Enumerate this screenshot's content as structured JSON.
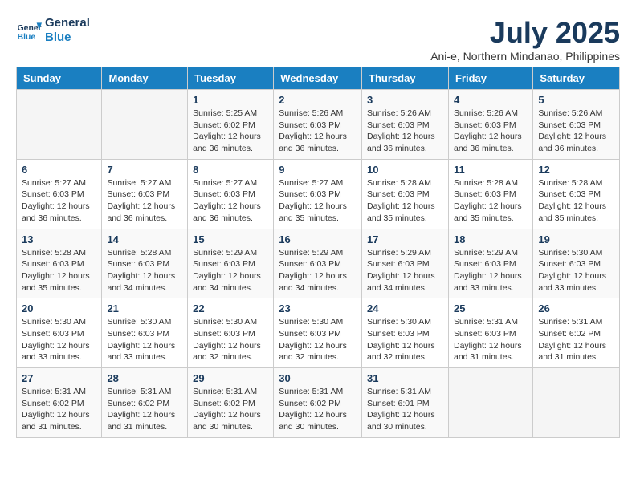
{
  "header": {
    "logo_line1": "General",
    "logo_line2": "Blue",
    "main_title": "July 2025",
    "subtitle": "Ani-e, Northern Mindanao, Philippines"
  },
  "weekdays": [
    "Sunday",
    "Monday",
    "Tuesday",
    "Wednesday",
    "Thursday",
    "Friday",
    "Saturday"
  ],
  "weeks": [
    [
      {
        "day": "",
        "detail": ""
      },
      {
        "day": "",
        "detail": ""
      },
      {
        "day": "1",
        "detail": "Sunrise: 5:25 AM\nSunset: 6:02 PM\nDaylight: 12 hours\nand 36 minutes."
      },
      {
        "day": "2",
        "detail": "Sunrise: 5:26 AM\nSunset: 6:03 PM\nDaylight: 12 hours\nand 36 minutes."
      },
      {
        "day": "3",
        "detail": "Sunrise: 5:26 AM\nSunset: 6:03 PM\nDaylight: 12 hours\nand 36 minutes."
      },
      {
        "day": "4",
        "detail": "Sunrise: 5:26 AM\nSunset: 6:03 PM\nDaylight: 12 hours\nand 36 minutes."
      },
      {
        "day": "5",
        "detail": "Sunrise: 5:26 AM\nSunset: 6:03 PM\nDaylight: 12 hours\nand 36 minutes."
      }
    ],
    [
      {
        "day": "6",
        "detail": "Sunrise: 5:27 AM\nSunset: 6:03 PM\nDaylight: 12 hours\nand 36 minutes."
      },
      {
        "day": "7",
        "detail": "Sunrise: 5:27 AM\nSunset: 6:03 PM\nDaylight: 12 hours\nand 36 minutes."
      },
      {
        "day": "8",
        "detail": "Sunrise: 5:27 AM\nSunset: 6:03 PM\nDaylight: 12 hours\nand 36 minutes."
      },
      {
        "day": "9",
        "detail": "Sunrise: 5:27 AM\nSunset: 6:03 PM\nDaylight: 12 hours\nand 35 minutes."
      },
      {
        "day": "10",
        "detail": "Sunrise: 5:28 AM\nSunset: 6:03 PM\nDaylight: 12 hours\nand 35 minutes."
      },
      {
        "day": "11",
        "detail": "Sunrise: 5:28 AM\nSunset: 6:03 PM\nDaylight: 12 hours\nand 35 minutes."
      },
      {
        "day": "12",
        "detail": "Sunrise: 5:28 AM\nSunset: 6:03 PM\nDaylight: 12 hours\nand 35 minutes."
      }
    ],
    [
      {
        "day": "13",
        "detail": "Sunrise: 5:28 AM\nSunset: 6:03 PM\nDaylight: 12 hours\nand 35 minutes."
      },
      {
        "day": "14",
        "detail": "Sunrise: 5:28 AM\nSunset: 6:03 PM\nDaylight: 12 hours\nand 34 minutes."
      },
      {
        "day": "15",
        "detail": "Sunrise: 5:29 AM\nSunset: 6:03 PM\nDaylight: 12 hours\nand 34 minutes."
      },
      {
        "day": "16",
        "detail": "Sunrise: 5:29 AM\nSunset: 6:03 PM\nDaylight: 12 hours\nand 34 minutes."
      },
      {
        "day": "17",
        "detail": "Sunrise: 5:29 AM\nSunset: 6:03 PM\nDaylight: 12 hours\nand 34 minutes."
      },
      {
        "day": "18",
        "detail": "Sunrise: 5:29 AM\nSunset: 6:03 PM\nDaylight: 12 hours\nand 33 minutes."
      },
      {
        "day": "19",
        "detail": "Sunrise: 5:30 AM\nSunset: 6:03 PM\nDaylight: 12 hours\nand 33 minutes."
      }
    ],
    [
      {
        "day": "20",
        "detail": "Sunrise: 5:30 AM\nSunset: 6:03 PM\nDaylight: 12 hours\nand 33 minutes."
      },
      {
        "day": "21",
        "detail": "Sunrise: 5:30 AM\nSunset: 6:03 PM\nDaylight: 12 hours\nand 33 minutes."
      },
      {
        "day": "22",
        "detail": "Sunrise: 5:30 AM\nSunset: 6:03 PM\nDaylight: 12 hours\nand 32 minutes."
      },
      {
        "day": "23",
        "detail": "Sunrise: 5:30 AM\nSunset: 6:03 PM\nDaylight: 12 hours\nand 32 minutes."
      },
      {
        "day": "24",
        "detail": "Sunrise: 5:30 AM\nSunset: 6:03 PM\nDaylight: 12 hours\nand 32 minutes."
      },
      {
        "day": "25",
        "detail": "Sunrise: 5:31 AM\nSunset: 6:03 PM\nDaylight: 12 hours\nand 31 minutes."
      },
      {
        "day": "26",
        "detail": "Sunrise: 5:31 AM\nSunset: 6:02 PM\nDaylight: 12 hours\nand 31 minutes."
      }
    ],
    [
      {
        "day": "27",
        "detail": "Sunrise: 5:31 AM\nSunset: 6:02 PM\nDaylight: 12 hours\nand 31 minutes."
      },
      {
        "day": "28",
        "detail": "Sunrise: 5:31 AM\nSunset: 6:02 PM\nDaylight: 12 hours\nand 31 minutes."
      },
      {
        "day": "29",
        "detail": "Sunrise: 5:31 AM\nSunset: 6:02 PM\nDaylight: 12 hours\nand 30 minutes."
      },
      {
        "day": "30",
        "detail": "Sunrise: 5:31 AM\nSunset: 6:02 PM\nDaylight: 12 hours\nand 30 minutes."
      },
      {
        "day": "31",
        "detail": "Sunrise: 5:31 AM\nSunset: 6:01 PM\nDaylight: 12 hours\nand 30 minutes."
      },
      {
        "day": "",
        "detail": ""
      },
      {
        "day": "",
        "detail": ""
      }
    ]
  ]
}
